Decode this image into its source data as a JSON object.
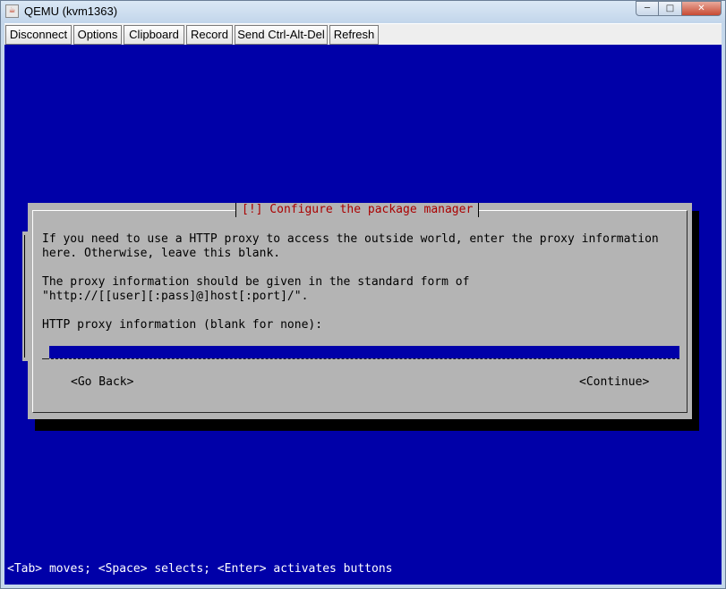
{
  "window": {
    "title": "QEMU (kvm1363)",
    "icon": "java-cup-icon",
    "controls": {
      "minimize": "─",
      "maximize": "□",
      "close": "✕"
    }
  },
  "toolbar": {
    "buttons": [
      {
        "label": "Disconnect"
      },
      {
        "label": "Options"
      },
      {
        "label": "Clipboard"
      },
      {
        "label": "Record"
      },
      {
        "label": "Send Ctrl-Alt-Del"
      },
      {
        "label": "Refresh"
      }
    ]
  },
  "dialog": {
    "title": "[!] Configure the package manager",
    "paragraph1_line1": "If you need to use a HTTP proxy to access the outside world, enter the proxy information",
    "paragraph1_line2": "here. Otherwise, leave this blank.",
    "paragraph2_line1": "The proxy information should be given in the standard form of",
    "paragraph2_line2": "\"http://[[user][:pass]@]host[:port]/\".",
    "field_label": "HTTP proxy information (blank for none):",
    "field_value": "",
    "go_back_label": "<Go Back>",
    "continue_label": "<Continue>"
  },
  "status_bar": {
    "text": "<Tab> moves; <Space> selects; <Enter> activates buttons"
  },
  "colors": {
    "screen_background": "#0000a8",
    "dialog_background": "#b4b4b4",
    "dialog_title": "#aa0000",
    "status_text": "#ffffff"
  }
}
